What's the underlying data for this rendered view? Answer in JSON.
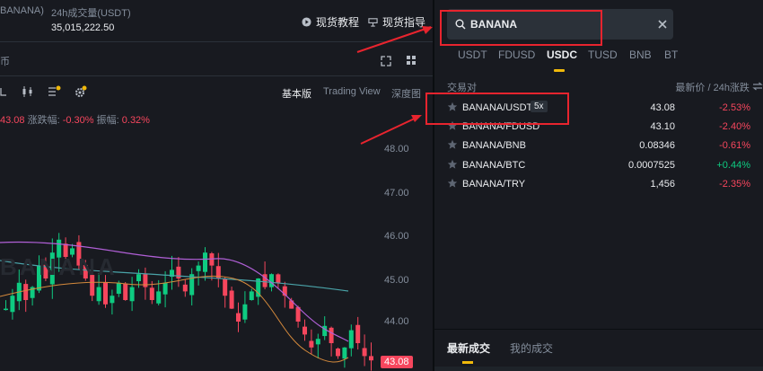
{
  "header": {
    "pair_fragment": "BANANA)",
    "volume_label": "24h成交量(USDT)",
    "volume_value": "35,015,222.50",
    "tutorial_label": "现货教程",
    "guide_label": "现货指导",
    "left_tab_fragment": "币"
  },
  "chart": {
    "views": [
      "基本版",
      "Trading View",
      "深度图"
    ],
    "stats": {
      "prefix": "43.08",
      "change_label": "涨跌幅:",
      "change_value": "-0.30%",
      "amp_label": "振幅:",
      "amp_value": "0.32%"
    },
    "y_ticks": [
      "48.00",
      "47.00",
      "46.00",
      "45.00",
      "44.00"
    ],
    "current_price": "43.08",
    "watermark": "BANANA",
    "colors": {
      "up": "#0ecb81",
      "down": "#f6465d",
      "ma_purple": "#b05fd6",
      "ma_teal": "#4aa3a8",
      "ma_orange": "#d58a3c"
    }
  },
  "search": {
    "value": "BANANA"
  },
  "quote_tabs": [
    "USDT",
    "FDUSD",
    "USDC",
    "TUSD",
    "BNB",
    "BT"
  ],
  "quote_tab_active": "USDC",
  "table": {
    "col_pair": "交易对",
    "col_price": "最新价",
    "col_sep": "/",
    "col_change": "24h涨跌"
  },
  "pairs": [
    {
      "name": "BANANA/USDT",
      "leverage": "5x",
      "price": "43.08",
      "change": "-2.53%",
      "dir": "down"
    },
    {
      "name": "BANANA/FDUSD",
      "price": "43.10",
      "change": "-2.40%",
      "dir": "down"
    },
    {
      "name": "BANANA/BNB",
      "price": "0.08346",
      "change": "-0.61%",
      "dir": "down"
    },
    {
      "name": "BANANA/BTC",
      "price": "0.0007525",
      "change": "+0.44%",
      "dir": "up"
    },
    {
      "name": "BANANA/TRY",
      "price": "1,456",
      "change": "-2.35%",
      "dir": "down"
    }
  ],
  "trades": {
    "tab_market": "最新成交",
    "tab_mine": "我的成交"
  },
  "accent_color": "#f0b90b",
  "highlight_color": "#e8242e"
}
